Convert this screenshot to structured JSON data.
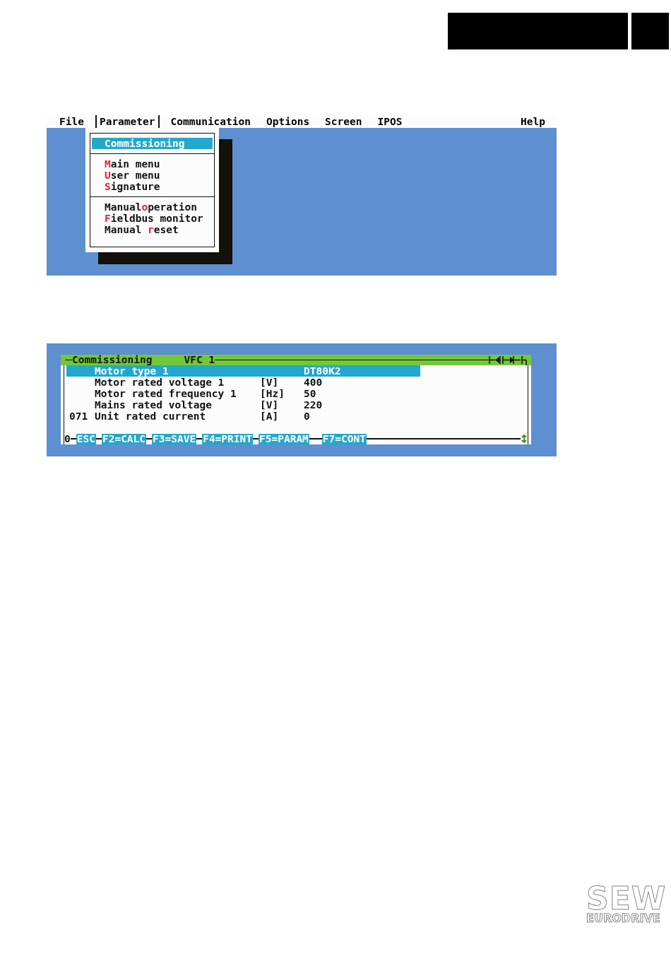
{
  "menu_bar": [
    {
      "label": "File",
      "selected": false
    },
    {
      "label": "Parameter",
      "selected": true
    },
    {
      "label": "Communication",
      "selected": false
    },
    {
      "label": "Options",
      "selected": false
    },
    {
      "label": "Screen",
      "selected": false
    },
    {
      "label": "IPOS",
      "selected": false
    },
    {
      "label": "Help",
      "selected": false
    }
  ],
  "dropdown": {
    "groups": [
      [
        {
          "before": "Commissioning",
          "selected": true
        }
      ],
      [
        {
          "hotkey": "M",
          "after": "ain menu",
          "selected": false
        },
        {
          "hotkey": "U",
          "after": "ser menu",
          "selected": false
        },
        {
          "hotkey": "S",
          "after": "ignature",
          "selected": false
        }
      ],
      [
        {
          "before": "Manual",
          "hotkey": "o",
          "after": "peration",
          "selected": false
        },
        {
          "hotkey": "F",
          "after": "ieldbus monitor",
          "selected": false
        },
        {
          "before": "Manual ",
          "hotkey": "r",
          "after": "eset",
          "selected": false
        }
      ]
    ]
  },
  "parameter_window": {
    "title": "Commissioning",
    "device": "VFC 1",
    "rows": [
      {
        "name": "Motor type 1",
        "value": "DT80K2",
        "selected": true
      },
      {
        "name": "Motor rated voltage 1",
        "unit": "[V]",
        "value": "400",
        "selected": false
      },
      {
        "name": "Motor rated frequency 1",
        "unit": "[Hz]",
        "value": "50",
        "selected": false
      },
      {
        "name": "Mains rated voltage",
        "unit": "[V]",
        "value": "220",
        "selected": false
      },
      {
        "number": "071",
        "name": "Unit rated current",
        "unit": "[A]",
        "value": "0",
        "selected": false
      }
    ],
    "status": "0",
    "keys": [
      "ESC",
      "F2=CALC",
      "F3=SAVE",
      "F4=PRINT",
      "F5=PARAM",
      "F7=CONT"
    ]
  },
  "logo": {
    "top": "SEW",
    "bottom": "EURODRIVE"
  }
}
